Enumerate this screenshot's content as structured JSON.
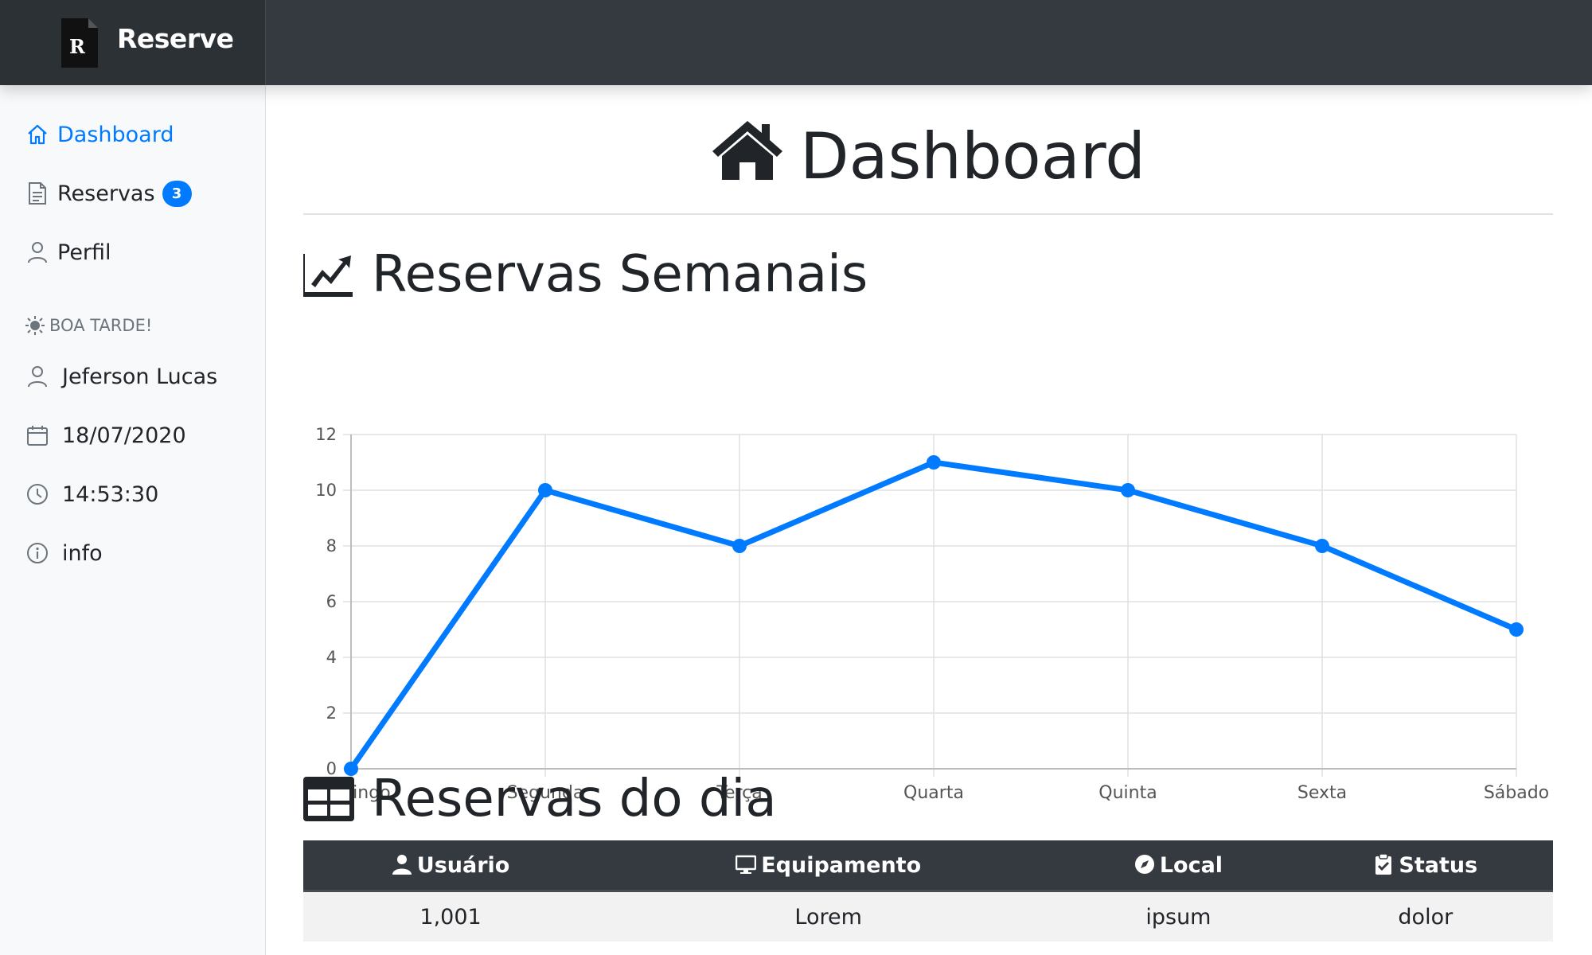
{
  "app": {
    "name": "Reserve",
    "logo_letter": "R"
  },
  "sidebar": {
    "items": [
      {
        "label": "Dashboard",
        "icon": "house-icon",
        "active": true
      },
      {
        "label": "Reservas",
        "icon": "document-icon",
        "badge": "3"
      },
      {
        "label": "Perfil",
        "icon": "person-icon"
      }
    ],
    "greeting": "BOA TARDE!",
    "user": "Jeferson Lucas",
    "date": "18/07/2020",
    "time": "14:53:30",
    "info": "info"
  },
  "main": {
    "title": "Dashboard",
    "chart_section_title": "Reservas Semanais",
    "table_section_title": "Reservas do dia"
  },
  "chart_data": {
    "type": "line",
    "categories": [
      "Domingo",
      "Segunda",
      "Terça",
      "Quarta",
      "Quinta",
      "Sexta",
      "Sábado"
    ],
    "series": [
      {
        "values": [
          0,
          10,
          8,
          11,
          10,
          8,
          5
        ],
        "color": "#007bff"
      }
    ],
    "ylim": [
      0,
      12
    ],
    "yticks": [
      0,
      2,
      4,
      6,
      8,
      10,
      12
    ],
    "grid": true,
    "legend": "none"
  },
  "table": {
    "headers": [
      "Usuário",
      "Equipamento",
      "Local",
      "Status"
    ],
    "header_icons": [
      "user-icon",
      "monitor-icon",
      "compass-icon",
      "clipboard-check-icon"
    ],
    "rows": [
      [
        "1,001",
        "Lorem",
        "ipsum",
        "dolor"
      ]
    ]
  },
  "colors": {
    "accent": "#007bff",
    "topbar": "#343a40",
    "sidebar": "#f8f9fa"
  }
}
